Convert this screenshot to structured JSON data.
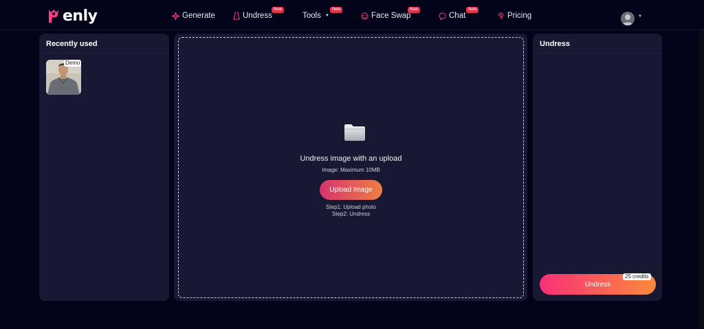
{
  "brand": {
    "name": "enly",
    "accent": "#ff2f7a"
  },
  "nav": {
    "items": [
      {
        "label": "Generate",
        "icon": "sparkle-icon",
        "new": ""
      },
      {
        "label": "Undress",
        "icon": "dress-icon",
        "new": "New"
      },
      {
        "label": "Tools",
        "icon": "",
        "new": "New"
      },
      {
        "label": "Face Swap",
        "icon": "face-icon",
        "new": "New"
      },
      {
        "label": "Chat",
        "icon": "chat-bubble-icon",
        "new": "New"
      },
      {
        "label": "Pricing",
        "icon": "fingerprint-icon",
        "new": ""
      }
    ]
  },
  "left_panel": {
    "title": "Recently used",
    "items": [
      {
        "tag": "Demo"
      }
    ]
  },
  "upload": {
    "title": "Undress image with an upload",
    "limit": "Image: Maximum 10MB",
    "button": "Upload Image",
    "step1": "Step1: Upload photo",
    "step2": "Step2: Undress"
  },
  "right_panel": {
    "title": "Undress",
    "button": "Undress",
    "credits": "25 credits"
  }
}
